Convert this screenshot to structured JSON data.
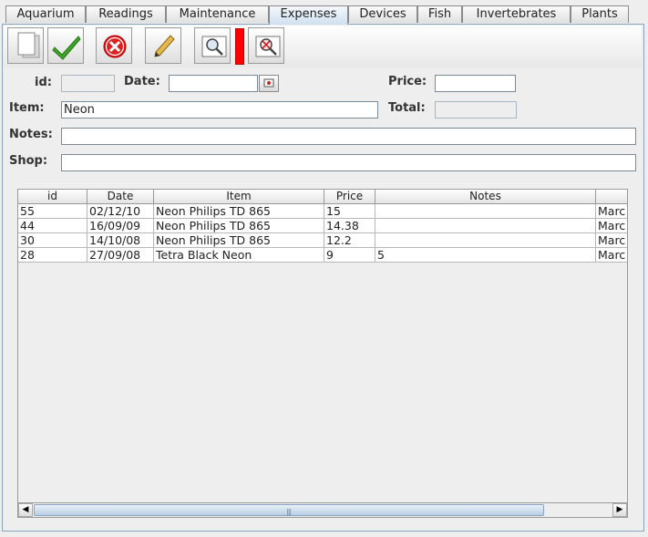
{
  "tabs": [
    {
      "label": "Aquarium"
    },
    {
      "label": "Readings"
    },
    {
      "label": "Maintenance"
    },
    {
      "label": "Expenses",
      "active": true
    },
    {
      "label": "Devices"
    },
    {
      "label": "Fish"
    },
    {
      "label": "Invertebrates"
    },
    {
      "label": "Plants"
    }
  ],
  "toolbar": {
    "buttons": [
      {
        "name": "new-button",
        "icon": "new-document-icon"
      },
      {
        "name": "save-button",
        "icon": "checkmark-icon"
      },
      {
        "name": "delete-button",
        "icon": "delete-icon"
      },
      {
        "name": "edit-button",
        "icon": "pencil-icon"
      },
      {
        "name": "search-button",
        "icon": "search-icon"
      },
      {
        "name": "clear-search-button",
        "icon": "clear-search-icon"
      }
    ],
    "accent_color": "#ff0000"
  },
  "form": {
    "id_label": "id:",
    "id_value": "",
    "date_label": "Date:",
    "date_value": "",
    "price_label": "Price:",
    "price_value": "",
    "item_label": "Item:",
    "item_value": "Neon",
    "total_label": "Total:",
    "total_value": "",
    "notes_label": "Notes:",
    "notes_value": "",
    "shop_label": "Shop:",
    "shop_value": ""
  },
  "table": {
    "columns": [
      "id",
      "Date",
      "Item",
      "Price",
      "Notes",
      ""
    ],
    "rows": [
      [
        "55",
        "02/12/10",
        "Neon Philips TD 865",
        "15",
        "",
        "Marc"
      ],
      [
        "44",
        "16/09/09",
        "Neon Philips TD 865",
        "14.38",
        "",
        "Marc"
      ],
      [
        "30",
        "14/10/08",
        "Neon Philips TD 865",
        "12.2",
        "",
        "Marc"
      ],
      [
        "28",
        "27/09/08",
        "Tetra Black Neon",
        "9",
        "5",
        "Marc"
      ]
    ]
  },
  "scrollbar": {
    "left_arrow": "◀",
    "right_arrow": "▶",
    "grip": "|||"
  }
}
